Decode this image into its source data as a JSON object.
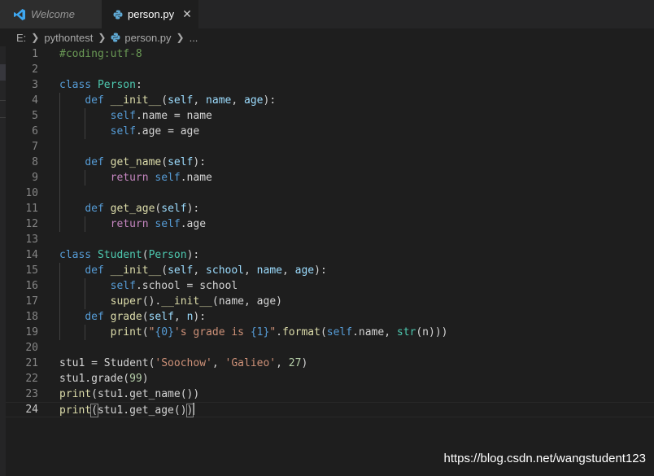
{
  "tabs": [
    {
      "label": "Welcome",
      "active": false
    },
    {
      "label": "person.py",
      "active": true,
      "close": "✕"
    }
  ],
  "breadcrumb": {
    "drive": "E:",
    "folder": "pythontest",
    "file": "person.py",
    "more": "..."
  },
  "watermark": "https://blog.csdn.net/wangstudent123",
  "colors": {
    "keyword": "#569cd6",
    "name": "#4ec9b0",
    "func": "#dcdcaa",
    "param": "#9cdcfe",
    "string": "#ce9178",
    "number": "#b5cea8",
    "comment": "#6a9955",
    "control": "#c586c0",
    "plain": "#d4d4d4"
  },
  "editor": {
    "lines": [
      [
        [
          "c",
          "#coding:utf-8"
        ]
      ],
      [],
      [
        [
          "k",
          "class"
        ],
        [
          "p",
          " "
        ],
        [
          "n",
          "Person"
        ],
        [
          "p",
          ":"
        ]
      ],
      [
        [
          "p",
          "    "
        ],
        [
          "k",
          "def"
        ],
        [
          "p",
          " "
        ],
        [
          "f",
          "__init__"
        ],
        [
          "p",
          "("
        ],
        [
          "v",
          "self"
        ],
        [
          "p",
          ", "
        ],
        [
          "v",
          "name"
        ],
        [
          "p",
          ", "
        ],
        [
          "v",
          "age"
        ],
        [
          "p",
          "):"
        ]
      ],
      [
        [
          "p",
          "        "
        ],
        [
          "k",
          "self"
        ],
        [
          "p",
          ".name = name"
        ]
      ],
      [
        [
          "p",
          "        "
        ],
        [
          "k",
          "self"
        ],
        [
          "p",
          ".age = age"
        ]
      ],
      [],
      [
        [
          "p",
          "    "
        ],
        [
          "k",
          "def"
        ],
        [
          "p",
          " "
        ],
        [
          "f",
          "get_name"
        ],
        [
          "p",
          "("
        ],
        [
          "v",
          "self"
        ],
        [
          "p",
          "):"
        ]
      ],
      [
        [
          "p",
          "        "
        ],
        [
          "r",
          "return"
        ],
        [
          "p",
          " "
        ],
        [
          "k",
          "self"
        ],
        [
          "p",
          ".name"
        ]
      ],
      [],
      [
        [
          "p",
          "    "
        ],
        [
          "k",
          "def"
        ],
        [
          "p",
          " "
        ],
        [
          "f",
          "get_age"
        ],
        [
          "p",
          "("
        ],
        [
          "v",
          "self"
        ],
        [
          "p",
          "):"
        ]
      ],
      [
        [
          "p",
          "        "
        ],
        [
          "r",
          "return"
        ],
        [
          "p",
          " "
        ],
        [
          "k",
          "self"
        ],
        [
          "p",
          ".age"
        ]
      ],
      [],
      [
        [
          "k",
          "class"
        ],
        [
          "p",
          " "
        ],
        [
          "n",
          "Student"
        ],
        [
          "p",
          "("
        ],
        [
          "n",
          "Person"
        ],
        [
          "p",
          "):"
        ]
      ],
      [
        [
          "p",
          "    "
        ],
        [
          "k",
          "def"
        ],
        [
          "p",
          " "
        ],
        [
          "f",
          "__init__"
        ],
        [
          "p",
          "("
        ],
        [
          "v",
          "self"
        ],
        [
          "p",
          ", "
        ],
        [
          "v",
          "school"
        ],
        [
          "p",
          ", "
        ],
        [
          "v",
          "name"
        ],
        [
          "p",
          ", "
        ],
        [
          "v",
          "age"
        ],
        [
          "p",
          "):"
        ]
      ],
      [
        [
          "p",
          "        "
        ],
        [
          "k",
          "self"
        ],
        [
          "p",
          ".school = school"
        ]
      ],
      [
        [
          "p",
          "        "
        ],
        [
          "f",
          "super"
        ],
        [
          "p",
          "()."
        ],
        [
          "f",
          "__init__"
        ],
        [
          "p",
          "(name, age)"
        ]
      ],
      [
        [
          "p",
          "    "
        ],
        [
          "k",
          "def"
        ],
        [
          "p",
          " "
        ],
        [
          "f",
          "grade"
        ],
        [
          "p",
          "("
        ],
        [
          "v",
          "self"
        ],
        [
          "p",
          ", "
        ],
        [
          "v",
          "n"
        ],
        [
          "p",
          "):"
        ]
      ],
      [
        [
          "p",
          "        "
        ],
        [
          "f",
          "print"
        ],
        [
          "p",
          "("
        ],
        [
          "s",
          "\""
        ],
        [
          "k",
          "{0}"
        ],
        [
          "s",
          "'s grade is "
        ],
        [
          "k",
          "{1}"
        ],
        [
          "s",
          "\""
        ],
        [
          "p",
          "."
        ],
        [
          "f",
          "format"
        ],
        [
          "p",
          "("
        ],
        [
          "k",
          "self"
        ],
        [
          "p",
          ".name, "
        ],
        [
          "n",
          "str"
        ],
        [
          "p",
          "(n)))"
        ]
      ],
      [],
      [
        [
          "p",
          "stu1 = Student("
        ],
        [
          "s",
          "'Soochow'"
        ],
        [
          "p",
          ", "
        ],
        [
          "s",
          "'Galieo'"
        ],
        [
          "p",
          ", "
        ],
        [
          "m",
          "27"
        ],
        [
          "p",
          ")"
        ]
      ],
      [
        [
          "p",
          "stu1.grade("
        ],
        [
          "m",
          "99"
        ],
        [
          "p",
          ")"
        ]
      ],
      [
        [
          "f",
          "print"
        ],
        [
          "p",
          "(stu1.get_name())"
        ]
      ],
      [
        [
          "f",
          "print"
        ],
        [
          "b",
          "("
        ],
        [
          "p",
          "stu1.get_age()"
        ],
        [
          "b",
          ")"
        ],
        [
          "cur",
          ""
        ]
      ]
    ]
  }
}
